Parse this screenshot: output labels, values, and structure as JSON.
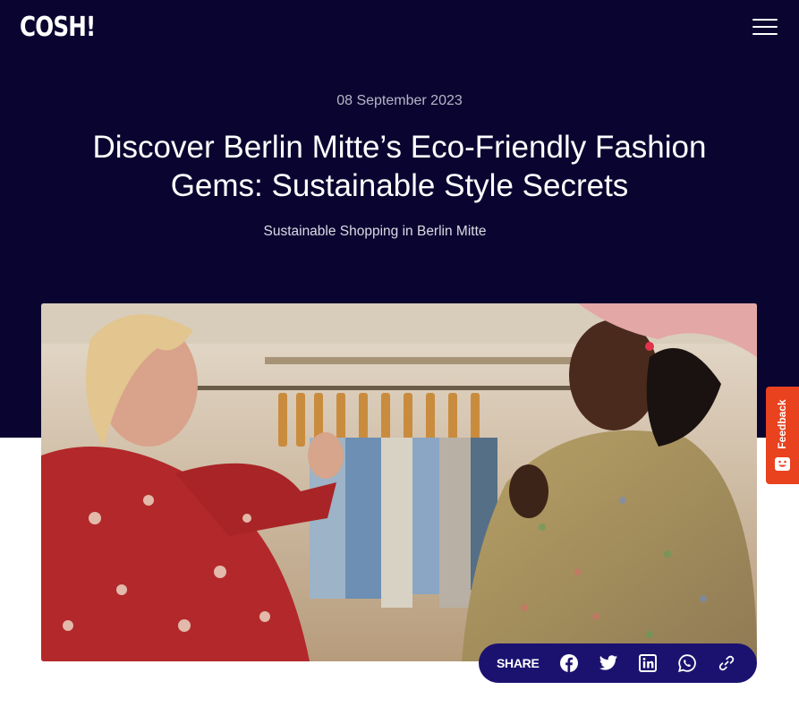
{
  "header": {
    "logo_text": "COSH!",
    "menu_icon": "hamburger-menu-icon"
  },
  "article": {
    "date": "08 September 2023",
    "title": "Discover Berlin Mitte’s Eco-Friendly Fashion Gems: Sustainable Style Secrets",
    "subtitle": "Sustainable Shopping in Berlin Mitte"
  },
  "feedback": {
    "label": "Feedback",
    "icon": "feedback-face-icon"
  },
  "share": {
    "label": "SHARE",
    "icons": [
      "facebook-icon",
      "twitter-icon",
      "linkedin-icon",
      "whatsapp-icon",
      "link-icon"
    ]
  },
  "colors": {
    "hero_background": "#0a0530",
    "share_bar": "#1b1270",
    "feedback_tab": "#e8421f"
  }
}
